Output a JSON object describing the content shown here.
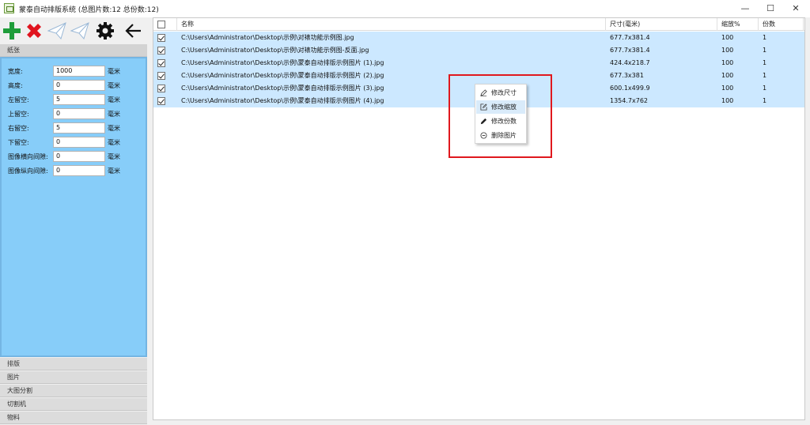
{
  "window": {
    "title": "蒙泰自动排版系统 (总图片数:12 总份数:12)",
    "minimize_glyph": "—",
    "maximize_glyph": "☐",
    "close_glyph": "✕"
  },
  "toolbar": {
    "tools": [
      "add-icon",
      "delete-icon",
      "send-icon",
      "send-outline-icon",
      "gear-icon",
      "arrow-left-icon"
    ]
  },
  "sidebar": {
    "paper_header": "纸张",
    "fields": [
      {
        "label": "宽度:",
        "value": "1000",
        "unit": "毫米"
      },
      {
        "label": "高度:",
        "value": "0",
        "unit": "毫米"
      },
      {
        "label": "左留空:",
        "value": "5",
        "unit": "毫米"
      },
      {
        "label": "上留空:",
        "value": "0",
        "unit": "毫米"
      },
      {
        "label": "右留空:",
        "value": "5",
        "unit": "毫米"
      },
      {
        "label": "下留空:",
        "value": "0",
        "unit": "毫米"
      },
      {
        "label": "图像横向间隙:",
        "value": "0",
        "unit": "毫米"
      },
      {
        "label": "图像纵向间隙:",
        "value": "0",
        "unit": "毫米"
      }
    ],
    "sections": [
      "排版",
      "图片",
      "大图分割",
      "切割机",
      "物料"
    ]
  },
  "grid": {
    "columns": {
      "name": "名称",
      "size": "尺寸(毫米)",
      "scale": "缩放%",
      "copies": "份数"
    },
    "rows": [
      {
        "name": "C:\\Users\\Administrator\\Desktop\\示例\\对裱功能示例图.jpg",
        "size": "677.7x381.4",
        "scale": "100",
        "copies": "1"
      },
      {
        "name": "C:\\Users\\Administrator\\Desktop\\示例\\对裱功能示例图-反面.jpg",
        "size": "677.7x381.4",
        "scale": "100",
        "copies": "1"
      },
      {
        "name": "C:\\Users\\Administrator\\Desktop\\示例\\蒙泰自动排版示例图片 (1).jpg",
        "size": "424.4x218.7",
        "scale": "100",
        "copies": "1"
      },
      {
        "name": "C:\\Users\\Administrator\\Desktop\\示例\\蒙泰自动排版示例图片 (2).jpg",
        "size": "677.3x381",
        "scale": "100",
        "copies": "1"
      },
      {
        "name": "C:\\Users\\Administrator\\Desktop\\示例\\蒙泰自动排版示例图片 (3).jpg",
        "size": "600.1x499.9",
        "scale": "100",
        "copies": "1"
      },
      {
        "name": "C:\\Users\\Administrator\\Desktop\\示例\\蒙泰自动排版示例图片 (4).jpg",
        "size": "1354.7x762",
        "scale": "100",
        "copies": "1"
      }
    ]
  },
  "context_menu": {
    "items": [
      {
        "label": "修改尺寸",
        "icon": "pencil-outline-icon"
      },
      {
        "label": "修改缩放",
        "icon": "edit-square-icon"
      },
      {
        "label": "修改份数",
        "icon": "pen-icon"
      },
      {
        "label": "删除图片",
        "icon": "remove-circle-icon"
      }
    ]
  },
  "colors": {
    "panel_blue": "#87cdf9",
    "row_selected": "#cce8ff",
    "highlight_red": "#e0181e",
    "add_green": "#1f9d3a",
    "delete_red": "#e0141e"
  }
}
